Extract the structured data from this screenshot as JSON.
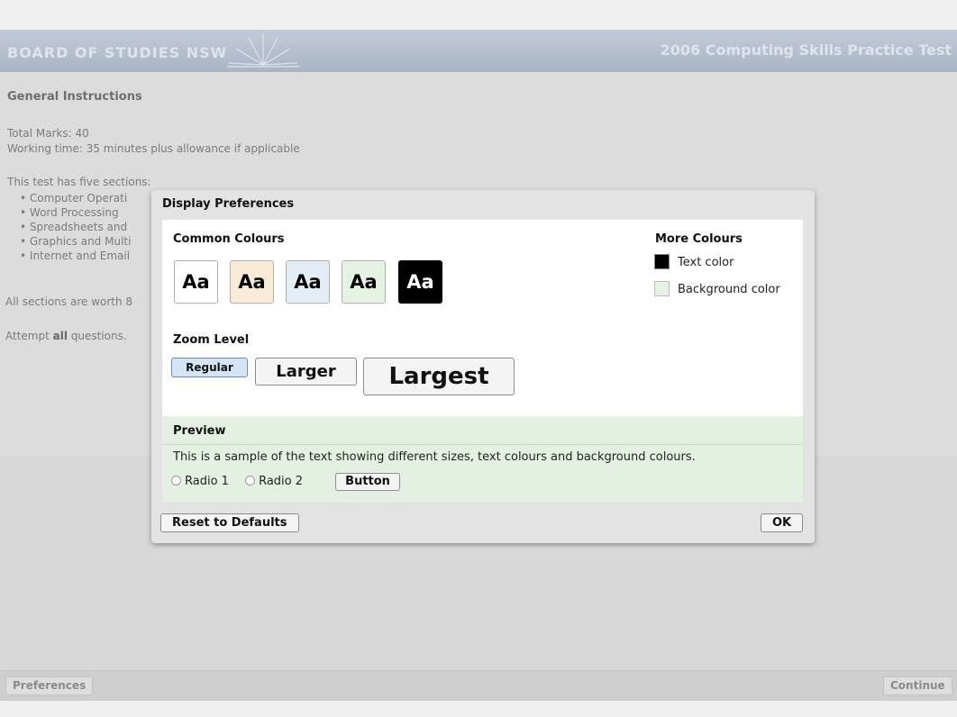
{
  "header": {
    "brand": "BOARD OF STUDIES NSW",
    "test_title": "2006 Computing Skills Practice Test"
  },
  "instructions": {
    "heading": "General Instructions",
    "total_marks": "Total Marks: 40",
    "working_time": "Working time: 35 minutes plus allowance if applicable",
    "sections_intro": "This test has five sections:",
    "sections": [
      "Computer Operati",
      "Word Processing",
      "Spreadsheets and",
      "Graphics and Multi",
      "Internet and Email"
    ],
    "worth": "All sections are worth 8",
    "attempt_prefix": "Attempt ",
    "attempt_bold": "all",
    "attempt_suffix": " questions."
  },
  "dialog": {
    "title": "Display Preferences",
    "common_colours_label": "Common Colours",
    "swatch_text": "Aa",
    "swatches": [
      {
        "bg": "#ffffff",
        "fg": "#000000"
      },
      {
        "bg": "#f8ecd7",
        "fg": "#000000"
      },
      {
        "bg": "#e4ecf5",
        "fg": "#000000"
      },
      {
        "bg": "#e5f3e4",
        "fg": "#000000"
      },
      {
        "bg": "#000000",
        "fg": "#ffffff"
      }
    ],
    "more_colours_label": "More Colours",
    "text_color_label": "Text color",
    "background_color_label": "Background color",
    "zoom_label": "Zoom Level",
    "zoom_options": [
      "Regular",
      "Larger",
      "Largest"
    ],
    "zoom_selected": "Regular",
    "preview": {
      "label": "Preview",
      "sample_text": "This is a sample of the text showing different sizes, text colours and background colours.",
      "radio1": "Radio 1",
      "radio2": "Radio 2",
      "button": "Button"
    },
    "reset_button": "Reset to Defaults",
    "ok_button": "OK"
  },
  "bottom_bar": {
    "preferences_button": "Preferences",
    "continue_button": "Continue"
  },
  "colors": {
    "header_bg": "#b3bdcd",
    "preview_bg": "#e4f1e2",
    "selected_zoom_bg": "#d6e5f5"
  }
}
